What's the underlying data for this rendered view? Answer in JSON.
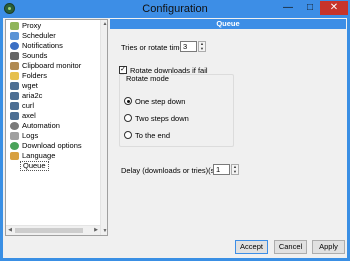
{
  "window": {
    "title": "Configuration"
  },
  "sidebar": {
    "items": [
      {
        "label": "Proxy",
        "icon": "proxy-icon",
        "color": "#8fb55a"
      },
      {
        "label": "Scheduler",
        "icon": "scheduler-icon",
        "color": "#5a93d6"
      },
      {
        "label": "Notifications",
        "icon": "info-icon",
        "color": "#3a6fc4"
      },
      {
        "label": "Sounds",
        "icon": "speaker-icon",
        "color": "#666666"
      },
      {
        "label": "Clipboard monitor",
        "icon": "clipboard-icon",
        "color": "#b08a52"
      },
      {
        "label": "Folders",
        "icon": "folder-icon",
        "color": "#e6c04e"
      },
      {
        "label": "wget",
        "icon": "terminal-icon",
        "color": "#4d6f93"
      },
      {
        "label": "aria2c",
        "icon": "terminal-icon",
        "color": "#4d6f93"
      },
      {
        "label": "curl",
        "icon": "terminal-icon",
        "color": "#4d6f93"
      },
      {
        "label": "axel",
        "icon": "terminal-icon",
        "color": "#4d6f93"
      },
      {
        "label": "Automation",
        "icon": "gear-icon",
        "color": "#7a7a7a"
      },
      {
        "label": "Logs",
        "icon": "logs-icon",
        "color": "#a0a0a0"
      },
      {
        "label": "Download options",
        "icon": "download-icon",
        "color": "#4aa35a"
      },
      {
        "label": "Language",
        "icon": "language-icon",
        "color": "#d8a040"
      },
      {
        "label": "Queue",
        "icon": "queue-icon",
        "color": "#ffffff"
      }
    ]
  },
  "panel": {
    "title": "Queue",
    "tries_label": "Tries or rotate times:",
    "tries_value": "3",
    "rotate_checkbox_label": "Rotate downloads if fail",
    "rotate_checked": true,
    "rotate_mode_title": "Rotate mode",
    "rotate_options": [
      {
        "label": "One step down",
        "selected": true
      },
      {
        "label": "Two steps down",
        "selected": false
      },
      {
        "label": "To the end",
        "selected": false
      }
    ],
    "delay_label": "Delay (downloads or tries)(sec):",
    "delay_value": "1"
  },
  "footer": {
    "accept": "Accept",
    "cancel": "Cancel",
    "apply": "Apply"
  },
  "colors": {
    "accent": "#3d8ee6",
    "close": "#c7342b"
  }
}
